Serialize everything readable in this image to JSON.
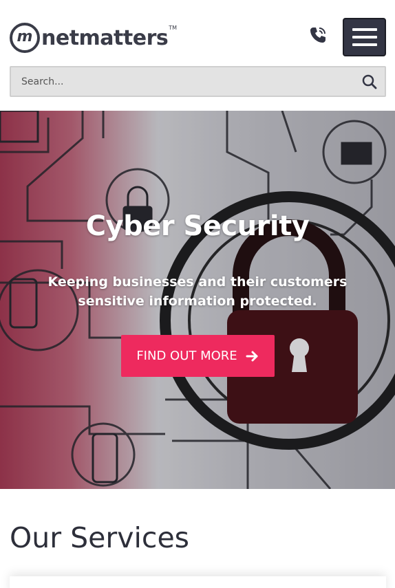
{
  "header": {
    "logo": {
      "mark": "m",
      "name": "netmatters",
      "trademark": "TM"
    },
    "phone_icon": "phone-icon",
    "menu_icon": "hamburger-menu-icon"
  },
  "search": {
    "placeholder": "Search...",
    "icon": "search-icon"
  },
  "hero": {
    "title": "Cyber Security",
    "subtitle": "Keeping businesses and their customers sensitive information protected.",
    "cta_label": "FIND OUT MORE",
    "cta_icon": "arrow-right-icon"
  },
  "services": {
    "title": "Our Services"
  },
  "colors": {
    "brand_dark": "#333544",
    "cta_pink": "#ee2a5e",
    "search_bg": "#e3e3e3",
    "hero_red": "#9b2c45"
  }
}
